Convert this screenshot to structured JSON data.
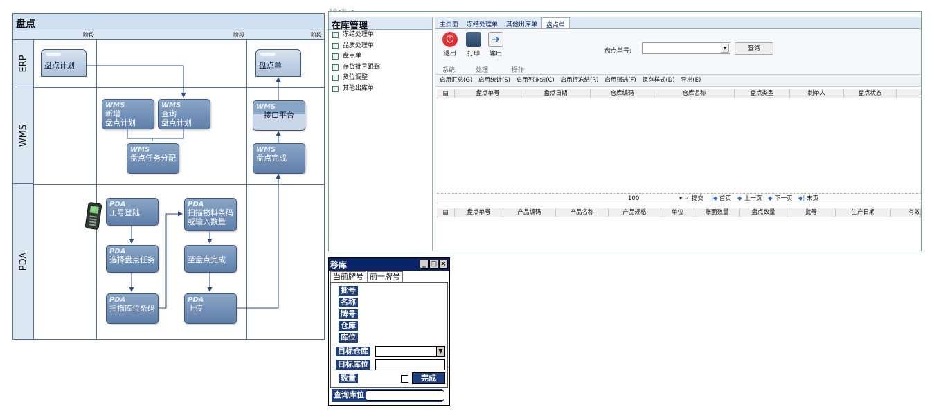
{
  "diagram": {
    "title": "盘点",
    "phase_label": "阶段",
    "lanes": [
      "ERP",
      "WMS",
      "PDA"
    ],
    "erp_docs": [
      "盘点计划",
      "盘点单"
    ],
    "wms_boxes": [
      {
        "tag": "WMS",
        "text": "新增\n盘点计划"
      },
      {
        "tag": "WMS",
        "text": "查询\n盘点计划"
      },
      {
        "tag": "WMS",
        "text": "盘点任务分配"
      },
      {
        "tag": "WMS",
        "text": "接口平台"
      },
      {
        "tag": "WMS",
        "text": "盘点完成"
      }
    ],
    "pda_boxes": [
      {
        "tag": "PDA",
        "text": "工号登陆"
      },
      {
        "tag": "PDA",
        "text": "选择盘点任务"
      },
      {
        "tag": "PDA",
        "text": "扫描库位条码"
      },
      {
        "tag": "PDA",
        "text": "扫描物料条码\n或输入数量"
      },
      {
        "tag": "",
        "text": "至盘点完成"
      },
      {
        "tag": "PDA",
        "text": "上传"
      }
    ]
  },
  "app": {
    "top_strip": "系统  ▾  别…  ▾",
    "sidebar": {
      "title": "在库管理",
      "items": [
        "冻结处理单",
        "品质处理单",
        "盘点单",
        "存货批号跟踪",
        "货位调整",
        "其他出库单"
      ]
    },
    "tabs": [
      "主页面",
      "冻结处理单",
      "其他出库单",
      "盘点单"
    ],
    "ribbon": {
      "exit": "退出",
      "print": "打印",
      "output": "输出",
      "groups": [
        "系统",
        "处理",
        "操作"
      ],
      "search_label": "盘点单号:",
      "search_value": "",
      "query": "查询"
    },
    "toolbar": [
      "启用汇总(G)",
      "启用统计(S)",
      "启用列冻结(C)",
      "启用行冻结(R)",
      "启用筛选(F)",
      "保存样式(D)",
      "导出(E)"
    ],
    "top_grid_cols": [
      "盘点单号",
      "盘点日期",
      "仓库编码",
      "仓库名称",
      "盘点类型",
      "制单人",
      "盘点状态"
    ],
    "pager": {
      "size": "100",
      "submit": "提交",
      "first": "首页",
      "prev": "上一页",
      "next": "下一页",
      "last": "末页"
    },
    "bottom_grid_cols": [
      "盘点单号",
      "产品编码",
      "产品名称",
      "产品规格",
      "单位",
      "账面数量",
      "盘点数量",
      "批号",
      "生产日期",
      "有效"
    ]
  },
  "dialog": {
    "title": "移库",
    "tabs": [
      "当前牌号",
      "前一牌号"
    ],
    "labels": [
      "批号",
      "名称",
      "牌号",
      "仓库",
      "库位"
    ],
    "target_wh": "目标仓库",
    "target_loc": "目标库位",
    "qty": "数量",
    "done": "完成",
    "query_loc": "查询库位"
  }
}
